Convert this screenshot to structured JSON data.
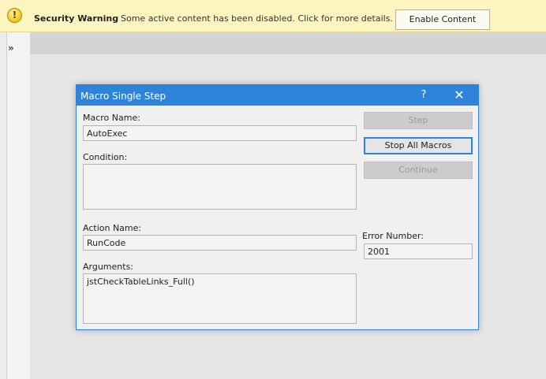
{
  "message_bar": {
    "icon": "warning-icon",
    "icon_glyph": "!",
    "title": "Security Warning",
    "text": "Some active content has been disabled. Click for more details.",
    "enable_button": "Enable Content"
  },
  "sidebar": {
    "expand_glyph": "»"
  },
  "dialog": {
    "title": "Macro Single Step",
    "help_glyph": "?",
    "close_glyph": "✕",
    "macro_name_label": "Macro Name:",
    "macro_name_value": "AutoExec",
    "condition_label": "Condition:",
    "condition_value": "",
    "action_name_label": "Action Name:",
    "action_name_value": "RunCode",
    "arguments_label": "Arguments:",
    "arguments_value": "jstCheckTableLinks_Full()",
    "error_number_label": "Error Number:",
    "error_number_value": "2001",
    "buttons": {
      "step": "Step",
      "stop_all": "Stop All Macros",
      "continue": "Continue"
    }
  },
  "colors": {
    "accent": "#2d84d8",
    "message_bar_bg": "#fdf4bf"
  }
}
